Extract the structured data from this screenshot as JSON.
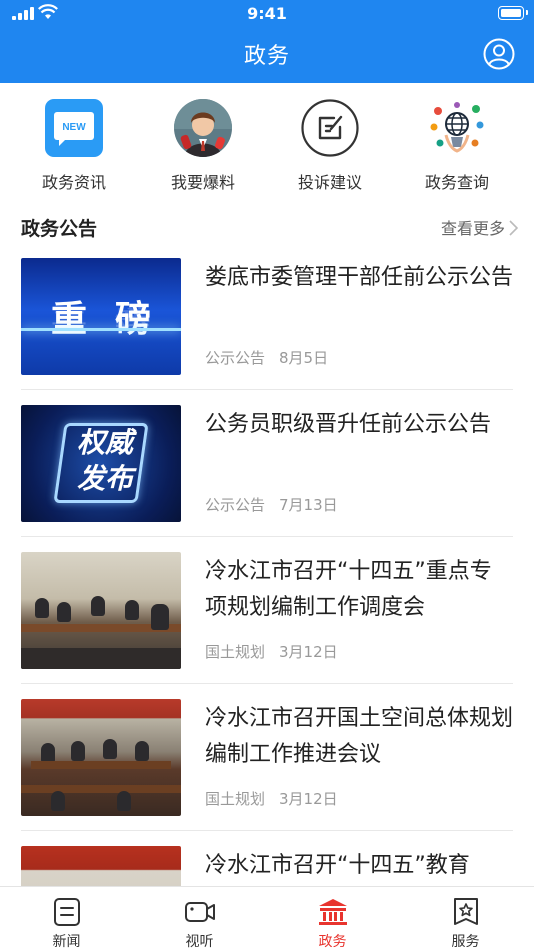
{
  "status_bar": {
    "time": "9:41"
  },
  "header": {
    "title": "政务"
  },
  "quick_entries": [
    {
      "label": "政务资讯",
      "icon": "news-icon",
      "badge": "NEW"
    },
    {
      "label": "我要爆料",
      "icon": "reporter-avatar-icon"
    },
    {
      "label": "投诉建议",
      "icon": "edit-note-icon"
    },
    {
      "label": "政务查询",
      "icon": "globe-query-icon"
    }
  ],
  "section": {
    "title": "政务公告",
    "more_label": "查看更多"
  },
  "news": [
    {
      "title": "娄底市委管理干部任前公示公告",
      "category": "公示公告",
      "date": "8月5日",
      "thumb": {
        "type": "heavy",
        "text": "重磅"
      }
    },
    {
      "title": "公务员职级晋升任前公示公告",
      "category": "公示公告",
      "date": "7月13日",
      "thumb": {
        "type": "authority",
        "line1": "权威",
        "line2": "发布"
      }
    },
    {
      "title": "冷水江市召开“十四五”重点专项规划编制工作调度会",
      "category": "国土规划",
      "date": "3月12日",
      "thumb": {
        "type": "meeting-photo"
      }
    },
    {
      "title": "冷水江市召开国土空间总体规划编制工作推进会议",
      "category": "国土规划",
      "date": "3月12日",
      "thumb": {
        "type": "meeting-photo"
      }
    },
    {
      "title": "冷水江市召开“十四五”教育",
      "category": "",
      "date": "",
      "thumb": {
        "type": "meeting-photo"
      }
    }
  ],
  "tabbar": [
    {
      "label": "新闻",
      "icon": "news-doc-icon",
      "active": false
    },
    {
      "label": "视听",
      "icon": "video-camera-icon",
      "active": false
    },
    {
      "label": "政务",
      "icon": "government-building-icon",
      "active": true
    },
    {
      "label": "服务",
      "icon": "service-badge-icon",
      "active": false
    }
  ],
  "colors": {
    "brand_blue": "#1f86f0",
    "active_red": "#e8342e",
    "meta_gray": "#999999"
  }
}
